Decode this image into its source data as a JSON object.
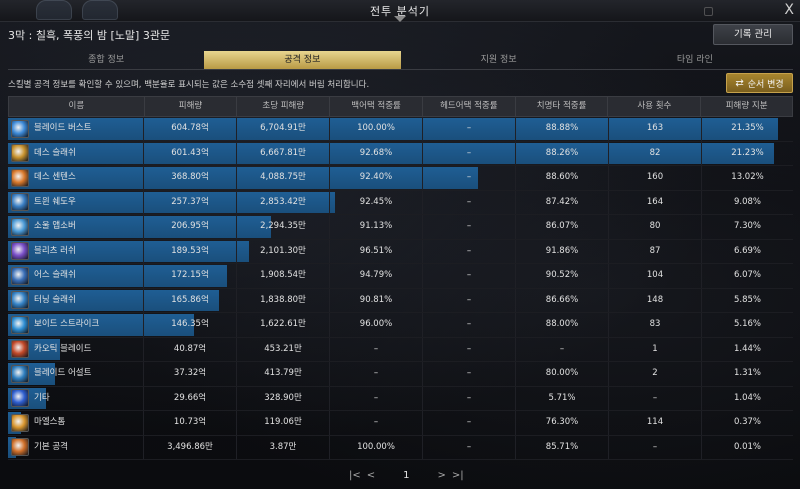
{
  "window": {
    "title": "전투 분석기",
    "close": "X"
  },
  "header": {
    "raid_name": "3막 : 칠흑, 폭풍의 밤 [노말]   3관문",
    "record_button": "기록 관리"
  },
  "tabs": [
    "종합 정보",
    "공격 정보",
    "지원 정보",
    "타임 라인"
  ],
  "active_tab": 1,
  "hint": "스킬별 공격 정보를 확인할 수 있으며, 백분율로 표시되는 값은 소수점 셋째 자리에서 버림 처리합니다.",
  "order_button": "순서 변경",
  "columns": [
    "이름",
    "피해량",
    "초당 피해량",
    "백어택 적중률",
    "헤드어택 적중률",
    "치명타 적중률",
    "사용 횟수",
    "피해량 지분"
  ],
  "rows": [
    {
      "name": "블레이드 버스트",
      "damage": "604.78억",
      "dps": "6,704.91만",
      "back": "100.00%",
      "head": "–",
      "crit": "88.88%",
      "uses": "163",
      "share": "21.35%",
      "share_value": 21.35,
      "icon_color": "#3d8ad8"
    },
    {
      "name": "데스 슬래쉬",
      "damage": "601.43억",
      "dps": "6,667.81만",
      "back": "92.68%",
      "head": "–",
      "crit": "88.26%",
      "uses": "82",
      "share": "21.23%",
      "share_value": 21.23,
      "icon_color": "#c8932f"
    },
    {
      "name": "데스 센텐스",
      "damage": "368.80억",
      "dps": "4,088.75만",
      "back": "92.40%",
      "head": "–",
      "crit": "88.60%",
      "uses": "160",
      "share": "13.02%",
      "share_value": 13.02,
      "icon_color": "#d8792c"
    },
    {
      "name": "트윈 쉐도우",
      "damage": "257.37억",
      "dps": "2,853.42만",
      "back": "92.45%",
      "head": "–",
      "crit": "87.42%",
      "uses": "164",
      "share": "9.08%",
      "share_value": 9.08,
      "icon_color": "#3a7fc4"
    },
    {
      "name": "소울 앱소버",
      "damage": "206.95억",
      "dps": "2,294.35만",
      "back": "91.13%",
      "head": "–",
      "crit": "86.07%",
      "uses": "80",
      "share": "7.30%",
      "share_value": 7.3,
      "icon_color": "#4a9ad6"
    },
    {
      "name": "블리츠 러쉬",
      "damage": "189.53억",
      "dps": "2,101.30만",
      "back": "96.51%",
      "head": "–",
      "crit": "91.86%",
      "uses": "87",
      "share": "6.69%",
      "share_value": 6.69,
      "icon_color": "#7a4fc8"
    },
    {
      "name": "어스 슬래쉬",
      "damage": "172.15억",
      "dps": "1,908.54만",
      "back": "94.79%",
      "head": "–",
      "crit": "90.52%",
      "uses": "104",
      "share": "6.07%",
      "share_value": 6.07,
      "icon_color": "#3a6fb8"
    },
    {
      "name": "터닝 슬래쉬",
      "damage": "165.86억",
      "dps": "1,838.80만",
      "back": "90.81%",
      "head": "–",
      "crit": "86.66%",
      "uses": "148",
      "share": "5.85%",
      "share_value": 5.85,
      "icon_color": "#3583c6"
    },
    {
      "name": "보이드 스트라이크",
      "damage": "146.35억",
      "dps": "1,622.61만",
      "back": "96.00%",
      "head": "–",
      "crit": "88.00%",
      "uses": "83",
      "share": "5.16%",
      "share_value": 5.16,
      "icon_color": "#2f8fd4"
    },
    {
      "name": "카오틱 블레이드",
      "damage": "40.87억",
      "dps": "453.21만",
      "back": "–",
      "head": "–",
      "crit": "–",
      "uses": "1",
      "share": "1.44%",
      "share_value": 1.44,
      "icon_color": "#c24a2a"
    },
    {
      "name": "블레이드 어설트",
      "damage": "37.32억",
      "dps": "413.79만",
      "back": "–",
      "head": "–",
      "crit": "80.00%",
      "uses": "2",
      "share": "1.31%",
      "share_value": 1.31,
      "icon_color": "#2f7fc0"
    },
    {
      "name": "기타",
      "damage": "29.66억",
      "dps": "328.90만",
      "back": "–",
      "head": "–",
      "crit": "5.71%",
      "uses": "–",
      "share": "1.04%",
      "share_value": 1.04,
      "icon_color": "#2f5fd0"
    },
    {
      "name": "마엘스톰",
      "damage": "10.73억",
      "dps": "119.06만",
      "back": "–",
      "head": "–",
      "crit": "76.30%",
      "uses": "114",
      "share": "0.37%",
      "share_value": 0.37,
      "icon_color": "#d8962f"
    },
    {
      "name": "기본 공격",
      "damage": "3,496.86만",
      "dps": "3.87만",
      "back": "100.00%",
      "head": "–",
      "crit": "85.71%",
      "uses": "–",
      "share": "0.01%",
      "share_value": 0.01,
      "icon_color": "#d0702a"
    }
  ],
  "pager": {
    "first": "|<",
    "prev": "<",
    "current": "1",
    "next": ">",
    "last": ">|"
  }
}
